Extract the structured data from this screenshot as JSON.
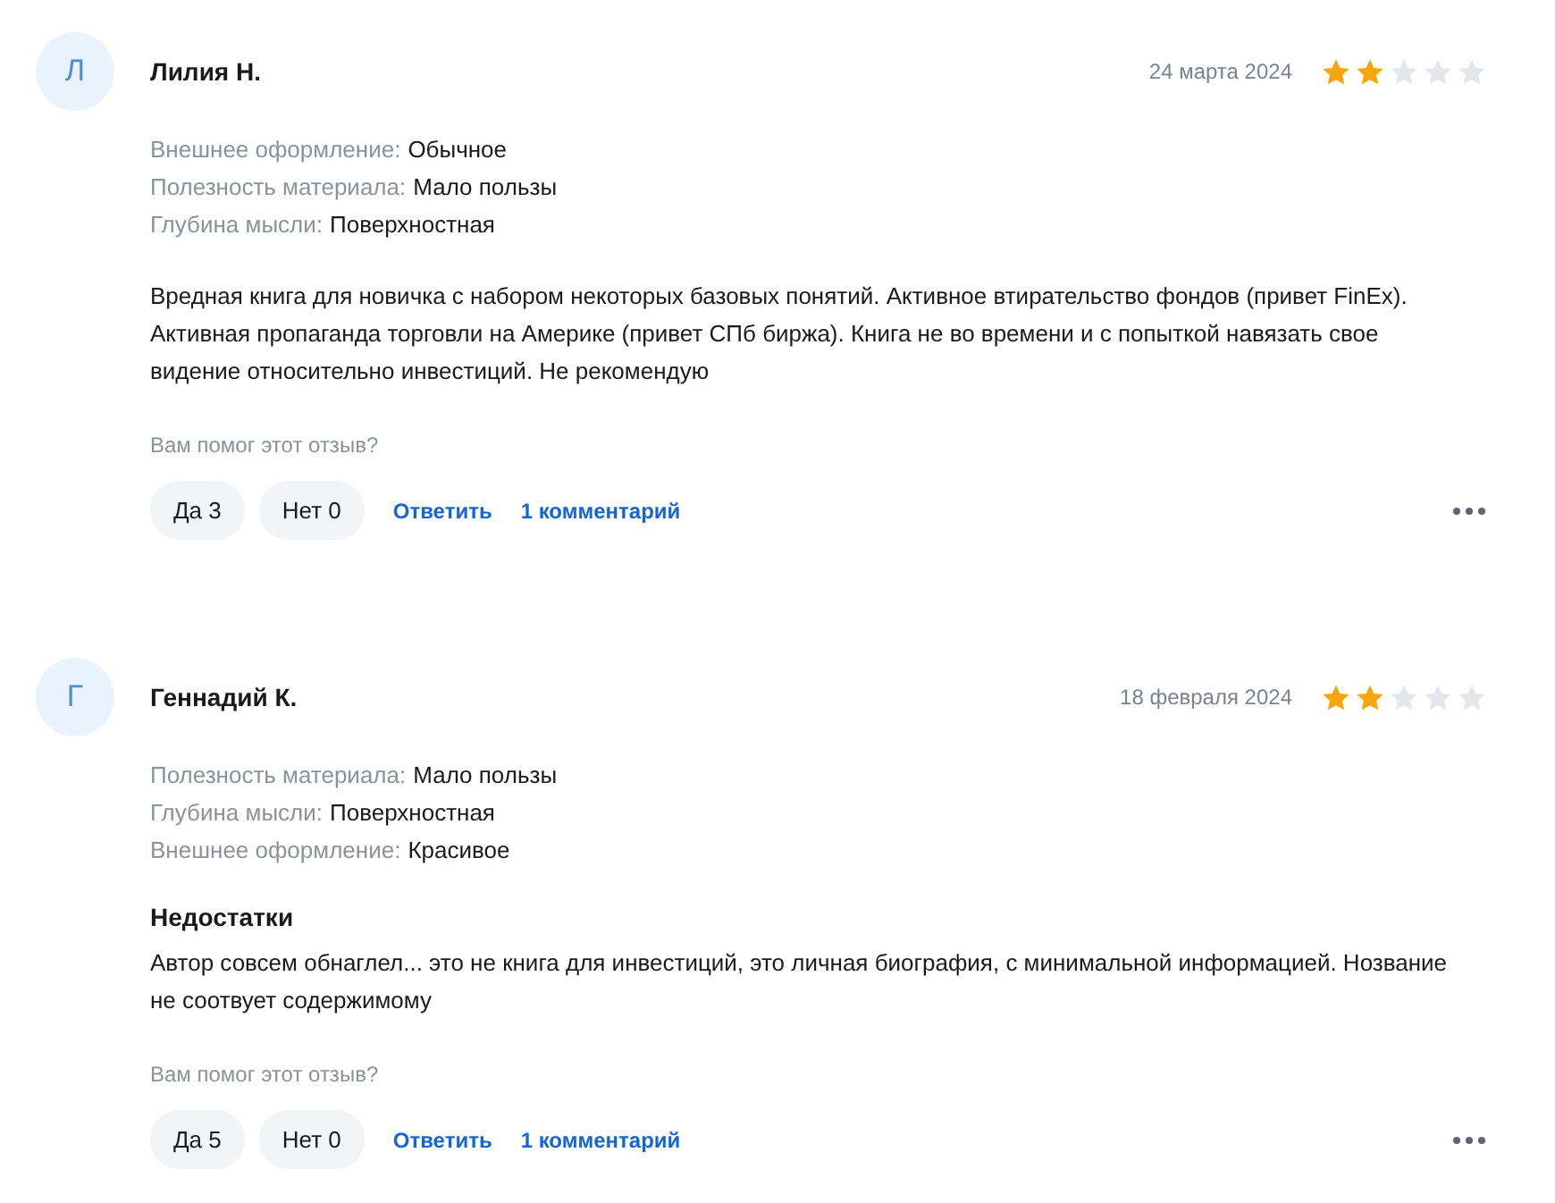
{
  "reviews": [
    {
      "avatar_letter": "Л",
      "name": "Лилия Н.",
      "date": "24 марта 2024",
      "stars": 2,
      "attributes": [
        {
          "label": "Внешнее оформление:",
          "value": "Обычное"
        },
        {
          "label": "Полезность материала:",
          "value": "Мало пользы"
        },
        {
          "label": "Глубина мысли:",
          "value": "Поверхностная"
        }
      ],
      "sections": [
        {
          "text": "Вредная книга для новичка с набором некоторых базовых понятий. Активное втирательство фондов (привет FinEx). Активная пропаганда торговли на Америке (привет СПб биржа). Книга не во времени и с попыткой навязать свое видение относительно инвестиций. Не рекомендую"
        }
      ],
      "helpful_prompt": "Вам помог этот отзыв?",
      "yes": "Да 3",
      "no": "Нет 0",
      "reply": "Ответить",
      "comments": "1 комментарий"
    },
    {
      "avatar_letter": "Г",
      "name": "Геннадий К.",
      "date": "18 февраля 2024",
      "stars": 2,
      "attributes": [
        {
          "label": "Полезность материала:",
          "value": "Мало пользы"
        },
        {
          "label": "Глубина мысли:",
          "value": "Поверхностная"
        },
        {
          "label": "Внешнее оформление:",
          "value": "Красивое"
        }
      ],
      "sections": [
        {
          "heading": "Недостатки",
          "text": "Автор совсем обнаглел... это не книга для инвестиций, это личная биография, с минимальной информацией. Нозвание не соотвует содержимому"
        }
      ],
      "helpful_prompt": "Вам помог этот отзыв?",
      "yes": "Да 5",
      "no": "Нет 0",
      "reply": "Ответить",
      "comments": "1 комментарий"
    }
  ]
}
